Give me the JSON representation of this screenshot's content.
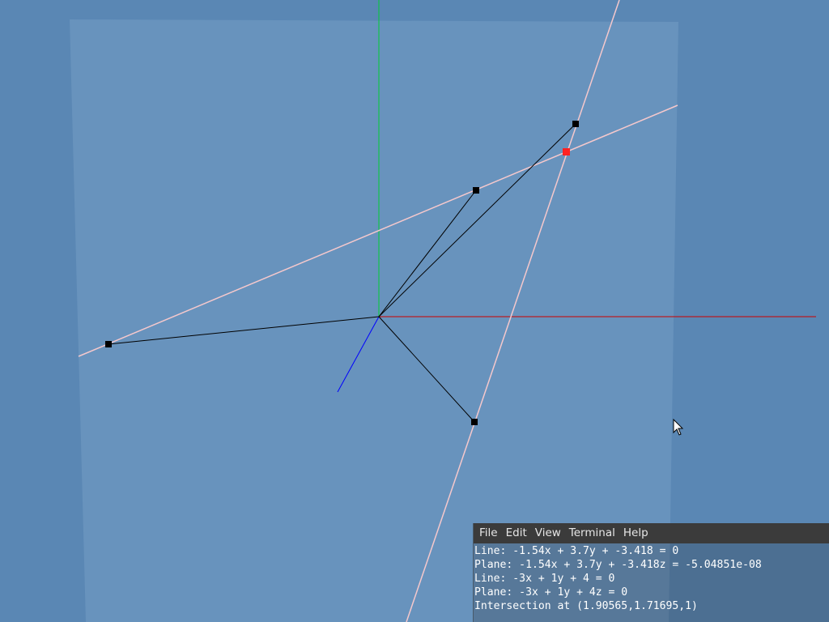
{
  "scene": {
    "background_color": "#5a87b4",
    "plane_color": "#6893bd",
    "axis_colors": {
      "x": "#cc0000",
      "y": "#00cc33",
      "z": "#0000ff"
    },
    "line_color": "#f5c8cc",
    "segment_color": "#000000",
    "control_point_color": "#000000",
    "intersection_point_color": "#ff2222"
  },
  "terminal": {
    "menu": {
      "file": "File",
      "edit": "Edit",
      "view": "View",
      "terminal": "Terminal",
      "help": "Help"
    },
    "lines": [
      "Line: -1.54x + 3.7y + -3.418 = 0",
      "Plane: -1.54x + 3.7y + -3.418z = -5.04851e-08",
      "Line: -3x + 1y + 4 = 0",
      "Plane: -3x + 1y + 4z = 0",
      "Intersection at (1.90565,1.71695,1)"
    ]
  }
}
